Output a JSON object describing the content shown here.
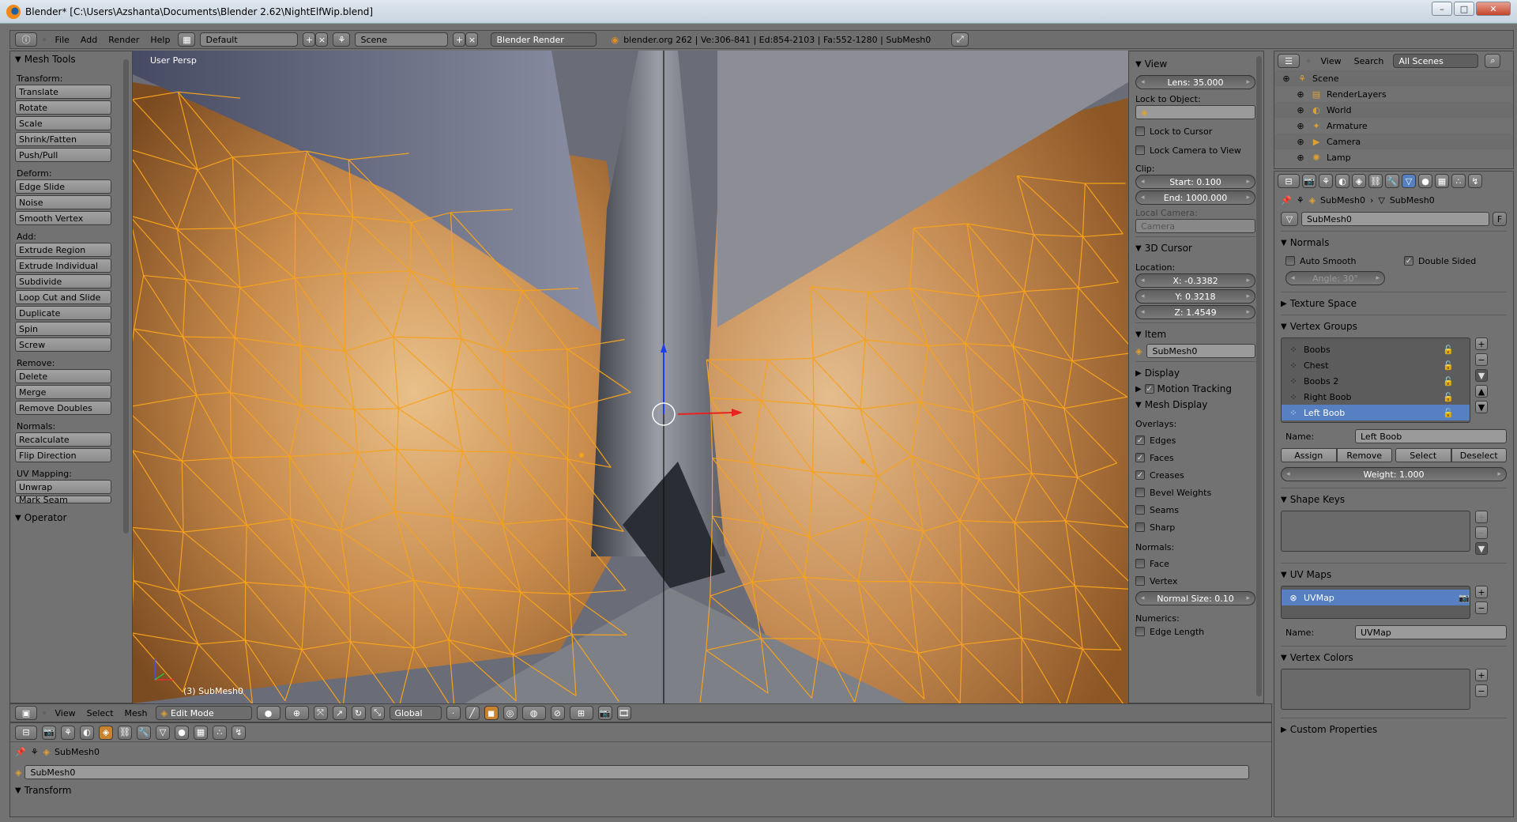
{
  "window": {
    "title": "Blender* [C:\\Users\\Azshanta\\Documents\\Blender 2.62\\NightElfWip.blend]",
    "min": "–",
    "max": "□",
    "close": "✕"
  },
  "header": {
    "menus": [
      "File",
      "Add",
      "Render",
      "Help"
    ],
    "layout": "Default",
    "scene": "Scene",
    "engine": "Blender Render",
    "stats": "blender.org 262 | Ve:306-841 | Ed:854-2103 | Fa:552-1280 | SubMesh0"
  },
  "toolshelf": {
    "title": "Mesh Tools",
    "sections": [
      {
        "label": "Transform:",
        "buttons": [
          "Translate",
          "Rotate",
          "Scale",
          "Shrink/Fatten",
          "Push/Pull"
        ]
      },
      {
        "label": "Deform:",
        "buttons": [
          "Edge Slide",
          "Noise",
          "Smooth Vertex"
        ]
      },
      {
        "label": "Add:",
        "buttons": [
          "Extrude Region",
          "Extrude Individual",
          "Subdivide",
          "Loop Cut and Slide",
          "Duplicate",
          "Spin",
          "Screw"
        ]
      },
      {
        "label": "Remove:",
        "buttons": [
          "Delete",
          "Merge",
          "Remove Doubles"
        ]
      },
      {
        "label": "Normals:",
        "buttons": [
          "Recalculate",
          "Flip Direction"
        ]
      },
      {
        "label": "UV Mapping:",
        "buttons": [
          "Unwrap",
          "Mark Seam"
        ]
      }
    ],
    "operator": "Operator"
  },
  "viewport": {
    "label": "User Persp",
    "object_label": "(3) SubMesh0",
    "colors": {
      "wire": "#f7a21b",
      "skin": "#c88b4c",
      "cloth": "#676c7d"
    }
  },
  "npanel": {
    "view": {
      "title": "View",
      "lens": "Lens: 35.000",
      "lock_to_object": "Lock to Object:",
      "lock_cursor": "Lock to Cursor",
      "lock_camera": "Lock Camera to View",
      "clip": "Clip:",
      "start": "Start: 0.100",
      "end": "End: 1000.000",
      "local_camera": "Local Camera:",
      "camera": "Camera"
    },
    "cursor": {
      "title": "3D Cursor",
      "location": "Location:",
      "x": "X: -0.3382",
      "y": "Y: 0.3218",
      "z": "Z: 1.4549"
    },
    "item": {
      "title": "Item",
      "name": "SubMesh0"
    },
    "display": {
      "title": "Display"
    },
    "motion": {
      "title": "Motion Tracking"
    },
    "mesh_display": {
      "title": "Mesh Display",
      "overlays": "Overlays:",
      "overlay_items": [
        {
          "label": "Edges",
          "checked": true
        },
        {
          "label": "Faces",
          "checked": true
        },
        {
          "label": "Creases",
          "checked": true
        },
        {
          "label": "Bevel Weights",
          "checked": false
        },
        {
          "label": "Seams",
          "checked": false
        },
        {
          "label": "Sharp",
          "checked": false
        }
      ],
      "normals": "Normals:",
      "normal_items": [
        {
          "label": "Face",
          "checked": false
        },
        {
          "label": "Vertex",
          "checked": false
        }
      ],
      "normal_size": "Normal Size: 0.10",
      "numerics": "Numerics:",
      "edge_length": "Edge Length"
    }
  },
  "view_header": {
    "menus": [
      "View",
      "Select",
      "Mesh"
    ],
    "mode": "Edit Mode",
    "orientation": "Global"
  },
  "bottom": {
    "path": "SubMesh0",
    "name": "SubMesh0",
    "transform": "Transform"
  },
  "outliner": {
    "menus": [
      "View",
      "Search"
    ],
    "filter": "All Scenes",
    "items": [
      {
        "label": "Scene",
        "indent": 0
      },
      {
        "label": "RenderLayers",
        "indent": 1
      },
      {
        "label": "World",
        "indent": 1
      },
      {
        "label": "Armature",
        "indent": 1
      },
      {
        "label": "Camera",
        "indent": 1
      },
      {
        "label": "Lamp",
        "indent": 1
      }
    ]
  },
  "properties": {
    "breadcrumb": [
      "SubMesh0",
      "SubMesh0"
    ],
    "mesh_name": "SubMesh0",
    "fake": "F",
    "normals": {
      "title": "Normals",
      "auto_smooth": "Auto Smooth",
      "double_sided": "Double Sided",
      "angle": "Angle: 30°"
    },
    "texture_space": "Texture Space",
    "vertex_groups": {
      "title": "Vertex Groups",
      "items": [
        "Boobs",
        "Chest",
        "Boobs 2",
        "Right Boob",
        "Left Boob"
      ],
      "selected": "Left Boob",
      "name_label": "Name:",
      "name": "Left Boob",
      "assign": "Assign",
      "remove": "Remove",
      "select": "Select",
      "deselect": "Deselect",
      "weight": "Weight: 1.000"
    },
    "shape_keys": "Shape Keys",
    "uv_maps": {
      "title": "UV Maps",
      "item": "UVMap",
      "name_label": "Name:",
      "name": "UVMap"
    },
    "vertex_colors": "Vertex Colors",
    "custom_props": "Custom Properties"
  }
}
